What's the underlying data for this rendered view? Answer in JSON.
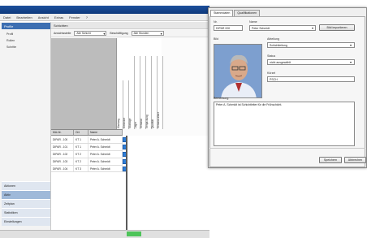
{
  "menu": [
    "Datei",
    "Bearbeiten",
    "Ansicht",
    "Extras",
    "Fenster",
    "?"
  ],
  "sidebar": {
    "header": "Profile",
    "items": [
      "Profil",
      "Rollen",
      "Schritte"
    ],
    "nav": [
      "Aktionen",
      "Aktiv",
      "Zeitplan",
      "Statistiken",
      "Einstellungen"
    ]
  },
  "main": {
    "header": "Schichten",
    "filter_label": "Ansichtsstelle",
    "filter_value": "Alle Schicht",
    "filter2_label": "Beschäftigung",
    "filter2_value": "Alle Stunden",
    "matrix_columns": [
      "Wartung",
      "Elektriker",
      "Montage",
      "Lager",
      "Versand",
      "Verpackung",
      "Qualität",
      "Versand-Ware"
    ],
    "table_headers": [
      "MA-Nr.",
      "Ort",
      "Name"
    ],
    "rows": [
      {
        "id": "DIPAR - 100",
        "ort": "KT 1",
        "name": "Peter A. Schmidt"
      },
      {
        "id": "DIPAR - 101",
        "ort": "KT 1",
        "name": "Peter A. Schmidt"
      },
      {
        "id": "DIPAR - 102",
        "ort": "KT 2",
        "name": "Peter A. Schmidt"
      },
      {
        "id": "DIPAR - 103",
        "ort": "KT 2",
        "name": "Peter A. Schmidt"
      },
      {
        "id": "DIPAR - 104",
        "ort": "KT 3",
        "name": "Peter A. Schmidt"
      }
    ]
  },
  "dialog": {
    "tabs": [
      "Stammdaten",
      "Qualifikationen"
    ],
    "id_label": "Nr.",
    "id_value": "DIPAR 000",
    "name_label": "Name",
    "name_value": "Peter Schmidt",
    "import_button": "Bild importieren",
    "photo_label": "Bild",
    "field1_label": "Abteilung",
    "field1_value": "Schichtleitung",
    "field2_label": "Status",
    "field2_value": "nicht ausgewählt",
    "field3_label": "Kürzel",
    "field3_value": "PSCH",
    "notes_label": "Bemerkung",
    "notes_value": "Peter A. Schmidt ist Schichtleiter für die Frühschicht.",
    "ok_button": "Speichern",
    "cancel_button": "Abbrechen"
  },
  "colors": {
    "titlebar": "#1d4f9c",
    "assigned": "#2f7fd8",
    "missing": "#d83a3a",
    "status_ok": "#4ec45a"
  }
}
